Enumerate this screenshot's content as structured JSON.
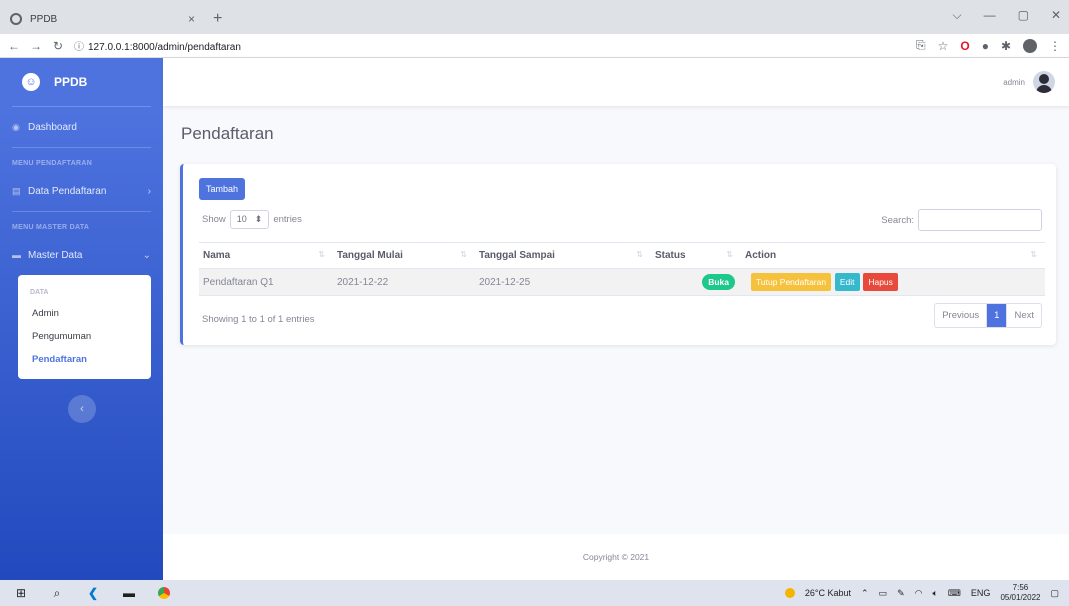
{
  "browser": {
    "tab_title": "PPDB",
    "tab_close": "×",
    "new_tab": "+",
    "url": "127.0.0.1:8000/admin/pendaftaran",
    "window_controls": [
      "⌵",
      "—",
      "▢",
      "✕"
    ]
  },
  "sidebar": {
    "brand": "PPDB",
    "dashboard": "Dashboard",
    "heading_pendaftaran": "MENU PENDAFTARAN",
    "data_pendaftaran": "Data Pendaftaran",
    "heading_master": "MENU MASTER DATA",
    "master_data": "Master Data",
    "collapse_header": "DATA",
    "collapse_items": [
      "Admin",
      "Pengumuman",
      "Pendaftaran"
    ],
    "toggle": "‹"
  },
  "topbar": {
    "user": "admin"
  },
  "page": {
    "title": "Pendaftaran"
  },
  "card": {
    "add_button": "Tambah",
    "show_label": "Show",
    "show_value": "10",
    "entries_label": "entries",
    "search_label": "Search:",
    "columns": [
      "Nama",
      "Tanggal Mulai",
      "Tanggal Sampai",
      "Status",
      "Action"
    ],
    "rows": [
      {
        "nama": "Pendaftaran Q1",
        "mulai": "2021-12-22",
        "sampai": "2021-12-25",
        "status": "Buka",
        "actions": [
          "Tutup Pendaftaran",
          "Edit",
          "Hapus"
        ]
      }
    ],
    "info": "Showing 1 to 1 of 1 entries",
    "pagination": {
      "previous": "Previous",
      "page": "1",
      "next": "Next"
    }
  },
  "footer": {
    "copyright": "Copyright © 2021"
  },
  "taskbar": {
    "weather": "26°C Kabut",
    "lang": "ENG",
    "time": "7:56",
    "date": "05/01/2022"
  },
  "colors": {
    "primary": "#4e73df",
    "success": "#1cc88a",
    "warning": "#f6c23e",
    "info": "#36b9cc",
    "danger": "#e74a3b"
  }
}
